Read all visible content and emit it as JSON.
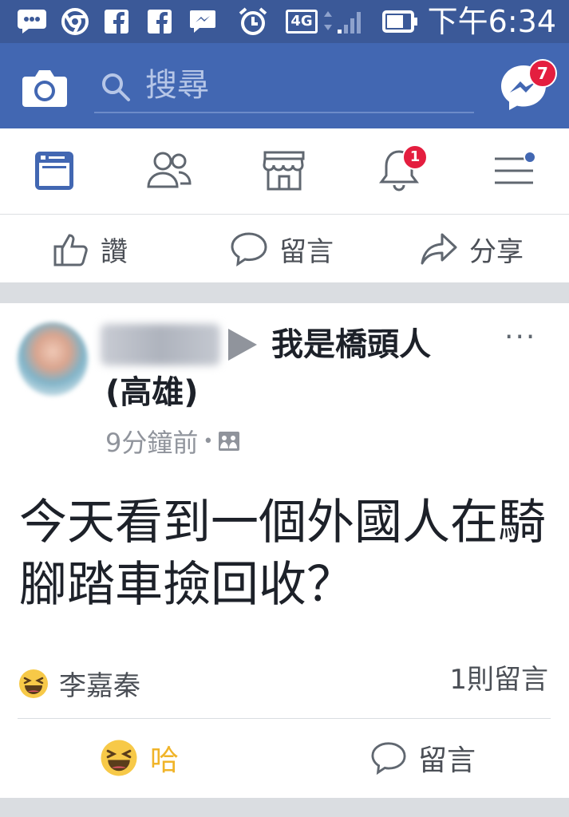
{
  "status_bar": {
    "time": "下午6:34",
    "network": "4G",
    "icons": [
      "bbm-chat-icon",
      "chrome-icon",
      "facebook-icon",
      "facebook-icon",
      "messenger-icon",
      "alarm-icon",
      "network-4g-icon",
      "signal-icon",
      "battery-icon"
    ]
  },
  "header": {
    "search_placeholder": "搜尋",
    "messenger_badge": "7",
    "icons": [
      "camera-icon",
      "search-icon",
      "messenger-icon"
    ]
  },
  "nav": {
    "notifications_badge": "1",
    "icons": [
      "news-feed-icon",
      "friends-icon",
      "marketplace-icon",
      "notifications-icon",
      "menu-icon"
    ]
  },
  "previous_post_actions": {
    "like": "讚",
    "comment": "留言",
    "share": "分享"
  },
  "post": {
    "group_name_line1": "我是橋頭人",
    "group_name_line2": "(高雄)",
    "timestamp": "9分鐘前",
    "separator": "•",
    "more": "···",
    "text": "今天看到一個外國人在騎腳踏車撿回收？",
    "reactor_name": "李嘉秦",
    "comment_count": "1則留言",
    "haha_label": "哈",
    "comment_label": "留言"
  },
  "colors": {
    "status_bar": "#3b5998",
    "header": "#4267b2",
    "nav_active": "#4267b2",
    "badge": "#e41e3f",
    "haha": "#f0b429",
    "divider": "#dadde1"
  }
}
